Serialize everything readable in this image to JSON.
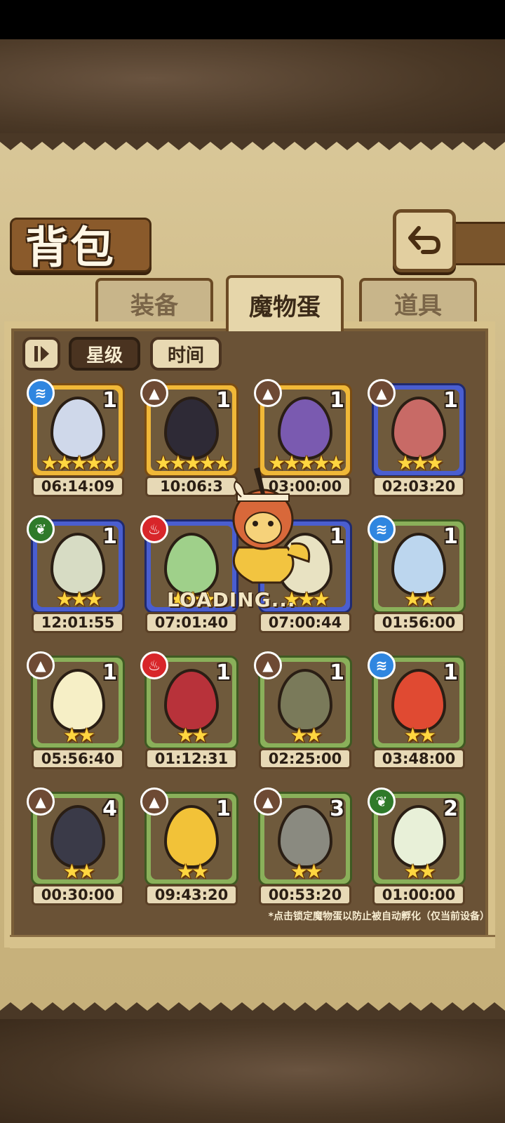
{
  "header": {
    "title": "背包",
    "back_icon": "return-arrow-icon"
  },
  "tabs": [
    {
      "label": "装备",
      "active": false
    },
    {
      "label": "魔物蛋",
      "active": true
    },
    {
      "label": "道具",
      "active": false
    }
  ],
  "sort": {
    "toggle_icon": "sort-toggle-icon",
    "options": [
      "星级",
      "时间"
    ],
    "active": "星级"
  },
  "eggs": [
    {
      "element": "water",
      "count": "1",
      "stars": 5,
      "time": "06:14:09",
      "frame": "gold"
    },
    {
      "element": "earth",
      "count": "1",
      "stars": 5,
      "time": "10:06:3",
      "frame": "gold"
    },
    {
      "element": "earth",
      "count": "1",
      "stars": 5,
      "time": "03:00:00",
      "frame": "gold"
    },
    {
      "element": "earth",
      "count": "1",
      "stars": 3,
      "time": "02:03:20",
      "frame": "blue"
    },
    {
      "element": "plant",
      "count": "1",
      "stars": 3,
      "time": "12:01:55",
      "frame": "blue"
    },
    {
      "element": "fire",
      "count": "",
      "stars": 3,
      "time": "07:01:40",
      "frame": "blue"
    },
    {
      "element": "",
      "count": "1",
      "stars": 3,
      "time": "07:00:44",
      "frame": "blue"
    },
    {
      "element": "water",
      "count": "1",
      "stars": 2,
      "time": "01:56:00",
      "frame": "green"
    },
    {
      "element": "earth",
      "count": "1",
      "stars": 2,
      "time": "05:56:40",
      "frame": "green"
    },
    {
      "element": "fire",
      "count": "1",
      "stars": 2,
      "time": "01:12:31",
      "frame": "green"
    },
    {
      "element": "earth",
      "count": "1",
      "stars": 2,
      "time": "02:25:00",
      "frame": "green"
    },
    {
      "element": "water",
      "count": "1",
      "stars": 2,
      "time": "03:48:00",
      "frame": "green"
    },
    {
      "element": "earth",
      "count": "4",
      "stars": 2,
      "time": "00:30:00",
      "frame": "green"
    },
    {
      "element": "earth",
      "count": "1",
      "stars": 2,
      "time": "09:43:20",
      "frame": "green"
    },
    {
      "element": "earth",
      "count": "3",
      "stars": 2,
      "time": "00:53:20",
      "frame": "green"
    },
    {
      "element": "plant",
      "count": "2",
      "stars": 2,
      "time": "01:00:00",
      "frame": "green"
    }
  ],
  "egg_colors": [
    "#cfd8ea",
    "#2e2a36",
    "#7a5ab0",
    "#c86a66",
    "#d7dcc4",
    "#9fd08a",
    "#e8e2c2",
    "#bcd6ee",
    "#f6efc6",
    "#b8323a",
    "#7a7a5a",
    "#e04a32",
    "#3a3a48",
    "#f2c238",
    "#8a8a80",
    "#e8f0d8"
  ],
  "loading_text": "LOADING...",
  "footer_note": "*点击锁定魔物蛋以防止被自动孵化（仅当前设备）"
}
